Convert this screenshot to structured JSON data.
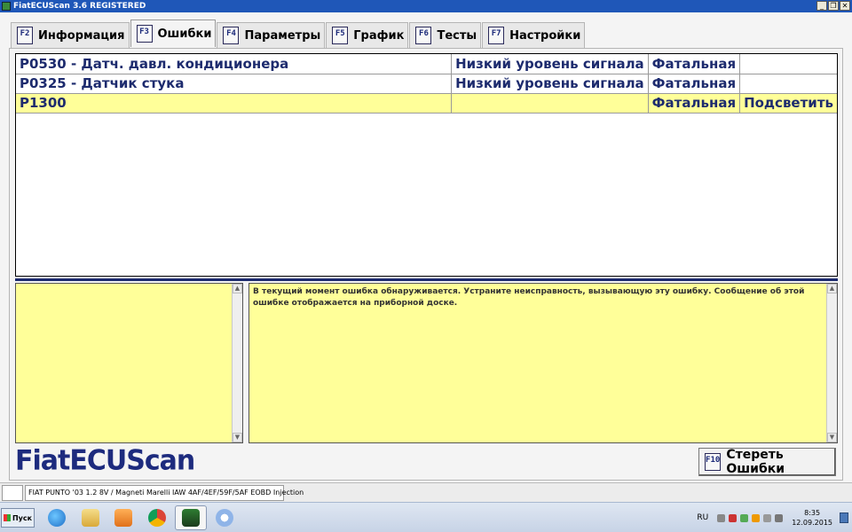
{
  "window": {
    "title": "FiatECUScan 3.6 REGISTERED",
    "controls": {
      "minimize": "_",
      "restore": "❐",
      "close": "✕"
    }
  },
  "tabs": [
    {
      "key": "F2",
      "label": "Информация",
      "active": false
    },
    {
      "key": "F3",
      "label": "Ошибки",
      "active": true
    },
    {
      "key": "F4",
      "label": "Параметры",
      "active": false
    },
    {
      "key": "F5",
      "label": "График",
      "active": false
    },
    {
      "key": "F6",
      "label": "Тесты",
      "active": false
    },
    {
      "key": "F7",
      "label": "Настройки",
      "active": false
    }
  ],
  "errors": [
    {
      "code": "P0530 - Датч. давл. кондиционера",
      "status": "Низкий уровень сигнала",
      "severity": "Фатальная",
      "action": "",
      "highlighted": false
    },
    {
      "code": "P0325 - Датчик стука",
      "status": "Низкий уровень сигнала",
      "severity": "Фатальная",
      "action": "",
      "highlighted": false
    },
    {
      "code": "P1300",
      "status": "",
      "severity": "Фатальная",
      "action": "Подсветить",
      "highlighted": true
    }
  ],
  "details": {
    "left_text": "",
    "right_text": "В текущий момент ошибка обнаруживается. Устраните неисправность, вызывающую эту ошибку. Сообщение об этой ошибке отображается на приборной доске."
  },
  "logo": "FiatECUScan",
  "clear_button": {
    "key": "F10",
    "label": "Стереть Ошибки"
  },
  "statusbar": {
    "vehicle": "FIAT PUNTO '03 1.2 8V / Magneti Marelli IAW 4AF/4EF/59F/5AF EOBD Injection"
  },
  "taskbar": {
    "start_label": "Пуск",
    "apps": [
      "ie-icon",
      "folder-icon",
      "media-player-icon",
      "chrome-icon",
      "fiatecuscan-icon",
      "paint-icon"
    ],
    "language": "RU",
    "time": "8:35",
    "date": "12.09.2015"
  },
  "colors": {
    "title_bar": "#1f57b8",
    "highlight": "#ffff99",
    "accent_text": "#1d2b6e",
    "logo": "#1d2b7e"
  }
}
